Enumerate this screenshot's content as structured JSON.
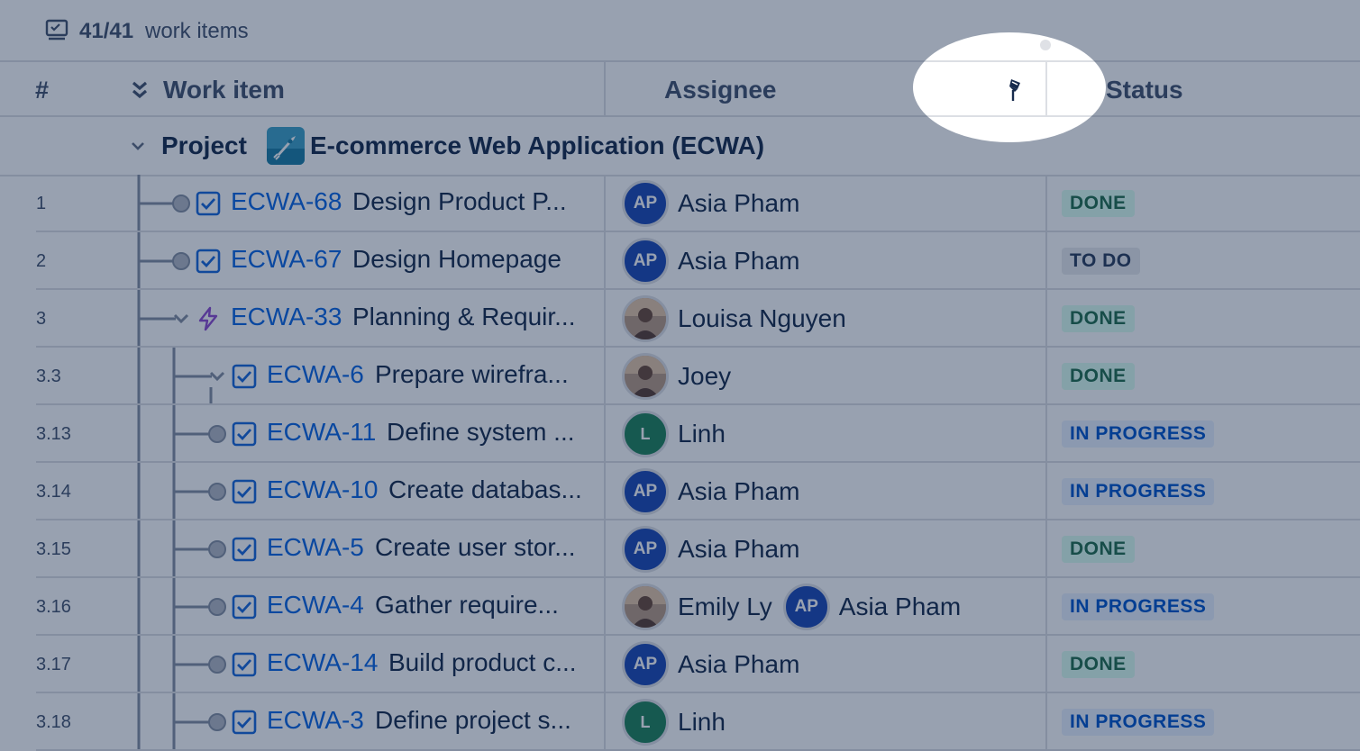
{
  "summary": {
    "count": "41/41",
    "label": "work items",
    "icon": "board-icon"
  },
  "header": {
    "num_label": "#",
    "expand_icon": "double-chevron-down-icon",
    "work_item_label": "Work item",
    "assignee_label": "Assignee",
    "pin_icon": "pin-icon",
    "status_label": "Status"
  },
  "group": {
    "label": "Project",
    "name": "E-commerce Web Application (ECWA)"
  },
  "rows": [
    {
      "num": "1",
      "key": "ECWA-68",
      "summary": "Design Product P...",
      "type": "task",
      "assignees": [
        {
          "initials": "AP",
          "name": "Asia Pham",
          "kind": "ap"
        }
      ],
      "status": "DONE",
      "status_kind": "done"
    },
    {
      "num": "2",
      "key": "ECWA-67",
      "summary": "Design Homepage",
      "type": "task",
      "assignees": [
        {
          "initials": "AP",
          "name": "Asia Pham",
          "kind": "ap"
        }
      ],
      "status": "TO DO",
      "status_kind": "todo"
    },
    {
      "num": "3",
      "key": "ECWA-33",
      "summary": "Planning & Requir...",
      "type": "epic",
      "assignees": [
        {
          "initials": "",
          "name": "Louisa Nguyen",
          "kind": "photo"
        }
      ],
      "status": "DONE",
      "status_kind": "done"
    },
    {
      "num": "3.3",
      "key": "ECWA-6",
      "summary": "Prepare wirefra...",
      "type": "task",
      "assignees": [
        {
          "initials": "",
          "name": "Joey",
          "kind": "photo"
        }
      ],
      "status": "DONE",
      "status_kind": "done"
    },
    {
      "num": "3.13",
      "key": "ECWA-11",
      "summary": "Define system ...",
      "type": "task",
      "assignees": [
        {
          "initials": "L",
          "name": "Linh",
          "kind": "l"
        }
      ],
      "status": "IN PROGRESS",
      "status_kind": "inprog"
    },
    {
      "num": "3.14",
      "key": "ECWA-10",
      "summary": "Create databas...",
      "type": "task",
      "assignees": [
        {
          "initials": "AP",
          "name": "Asia Pham",
          "kind": "ap"
        }
      ],
      "status": "IN PROGRESS",
      "status_kind": "inprog"
    },
    {
      "num": "3.15",
      "key": "ECWA-5",
      "summary": "Create user stor...",
      "type": "task",
      "assignees": [
        {
          "initials": "AP",
          "name": "Asia Pham",
          "kind": "ap"
        }
      ],
      "status": "DONE",
      "status_kind": "done"
    },
    {
      "num": "3.16",
      "key": "ECWA-4",
      "summary": "Gather require...",
      "type": "task",
      "assignees": [
        {
          "initials": "",
          "name": "Emily Ly",
          "kind": "photo"
        },
        {
          "initials": "AP",
          "name": "Asia Pham",
          "kind": "ap"
        }
      ],
      "status": "IN PROGRESS",
      "status_kind": "inprog"
    },
    {
      "num": "3.17",
      "key": "ECWA-14",
      "summary": "Build product c...",
      "type": "task",
      "assignees": [
        {
          "initials": "AP",
          "name": "Asia Pham",
          "kind": "ap"
        }
      ],
      "status": "DONE",
      "status_kind": "done"
    },
    {
      "num": "3.18",
      "key": "ECWA-3",
      "summary": "Define project s...",
      "type": "task",
      "assignees": [
        {
          "initials": "L",
          "name": "Linh",
          "kind": "l"
        }
      ],
      "status": "IN PROGRESS",
      "status_kind": "inprog"
    }
  ],
  "colors": {
    "link": "#0c66e4",
    "overlay": "rgba(9,30,66,0.45)",
    "avatar_ap": "#1d49b5",
    "avatar_l": "#1f845a"
  }
}
